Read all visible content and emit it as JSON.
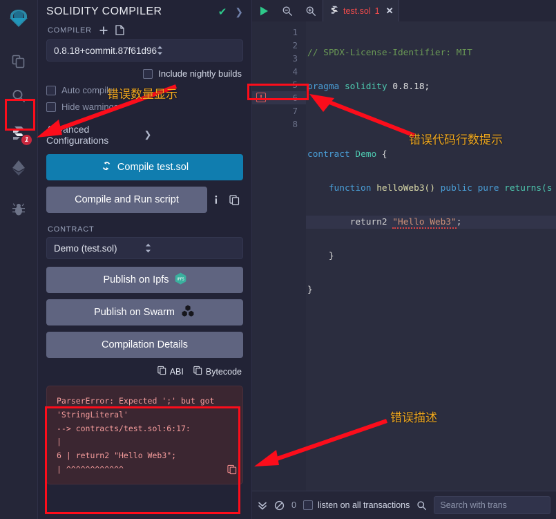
{
  "iconbar": {
    "items": [
      {
        "name": "remix-logo-icon",
        "label": "Remix"
      },
      {
        "name": "file-explorer-icon",
        "label": "File explorer"
      },
      {
        "name": "search-icon",
        "label": "Search in files"
      },
      {
        "name": "solidity-compiler-icon",
        "label": "Solidity compiler",
        "badge": "1"
      },
      {
        "name": "deploy-run-icon",
        "label": "Deploy & run transactions"
      },
      {
        "name": "debugger-icon",
        "label": "Debugger"
      }
    ]
  },
  "panel": {
    "title": "SOLIDITY COMPILER",
    "header_check": "✔",
    "header_chevron": "❯",
    "compiler_label": "COMPILER",
    "plus_icon": "+",
    "file_icon": "document-icon",
    "version": "0.8.18+commit.87f61d96",
    "include_nightly_label": "Include nightly builds",
    "auto_compile_label": "Auto compile",
    "hide_warnings_label": "Hide warnings",
    "advanced_label": "Advanced Configurations",
    "advanced_chevron": "❯",
    "compile_button": "Compile test.sol",
    "compile_run_button": "Compile and Run script",
    "contract_label": "CONTRACT",
    "contract_value": "Demo (test.sol)",
    "publish_ipfs": "Publish on Ipfs",
    "ipfs_badge": "IPFS",
    "publish_swarm": "Publish on Swarm",
    "compilation_details": "Compilation Details",
    "abi_label": "ABI",
    "bytecode_label": "Bytecode",
    "error_lines": [
      "ParserError: Expected ';' but got",
      "'StringLiteral'",
      "--> contracts/test.sol:6:17:",
      "|",
      "6 | return2 \"Hello Web3\";",
      "|  ^^^^^^^^^^^^"
    ]
  },
  "editor": {
    "run_icon": "play-icon",
    "zoom_out_icon": "zoom-out-icon",
    "zoom_in_icon": "zoom-in-icon",
    "tab_name": "test.sol",
    "tab_error_count": "1",
    "tab_close": "✕",
    "line_numbers": [
      "1",
      "2",
      "3",
      "4",
      "5",
      "6",
      "7",
      "8"
    ],
    "error_glyph_line": 6,
    "error_glyph": "!",
    "dot_glyph_line": 8,
    "code": {
      "l1_comment": "// SPDX-License-Identifier: MIT",
      "l2_kw": "pragma",
      "l2_name": "solidity",
      "l2_num": "0.8.18;",
      "l4_kw": "contract",
      "l4_name": "Demo",
      "l4_brace": "{",
      "l5_kw": "function",
      "l5_fn": "helloWeb3()",
      "l5_mod": "public pure",
      "l5_ret": "returns(s",
      "l6_stmt": "return2",
      "l6_str": "\"Hello Web3\"",
      "l6_semi": ";",
      "l7_brace": "}",
      "l8_brace": "}"
    }
  },
  "terminal": {
    "collapse_icon": "chevrons-down-icon",
    "clear_icon": "ban-icon",
    "count": "0",
    "listen_label": "listen on all transactions",
    "search_icon": "search-icon",
    "search_placeholder": "Search with trans"
  },
  "annotations": [
    {
      "name": "annotation-error-count",
      "text": "错误数量显示"
    },
    {
      "name": "annotation-error-line",
      "text": "错误代码行数提示"
    },
    {
      "name": "annotation-error-description",
      "text": "错误描述"
    }
  ],
  "colors": {
    "accent": "#107daf",
    "annotation": "#f0a81e",
    "highlight_box": "#fc0d1b",
    "badge": "#c9283e",
    "error_text": "#f59c9c"
  }
}
